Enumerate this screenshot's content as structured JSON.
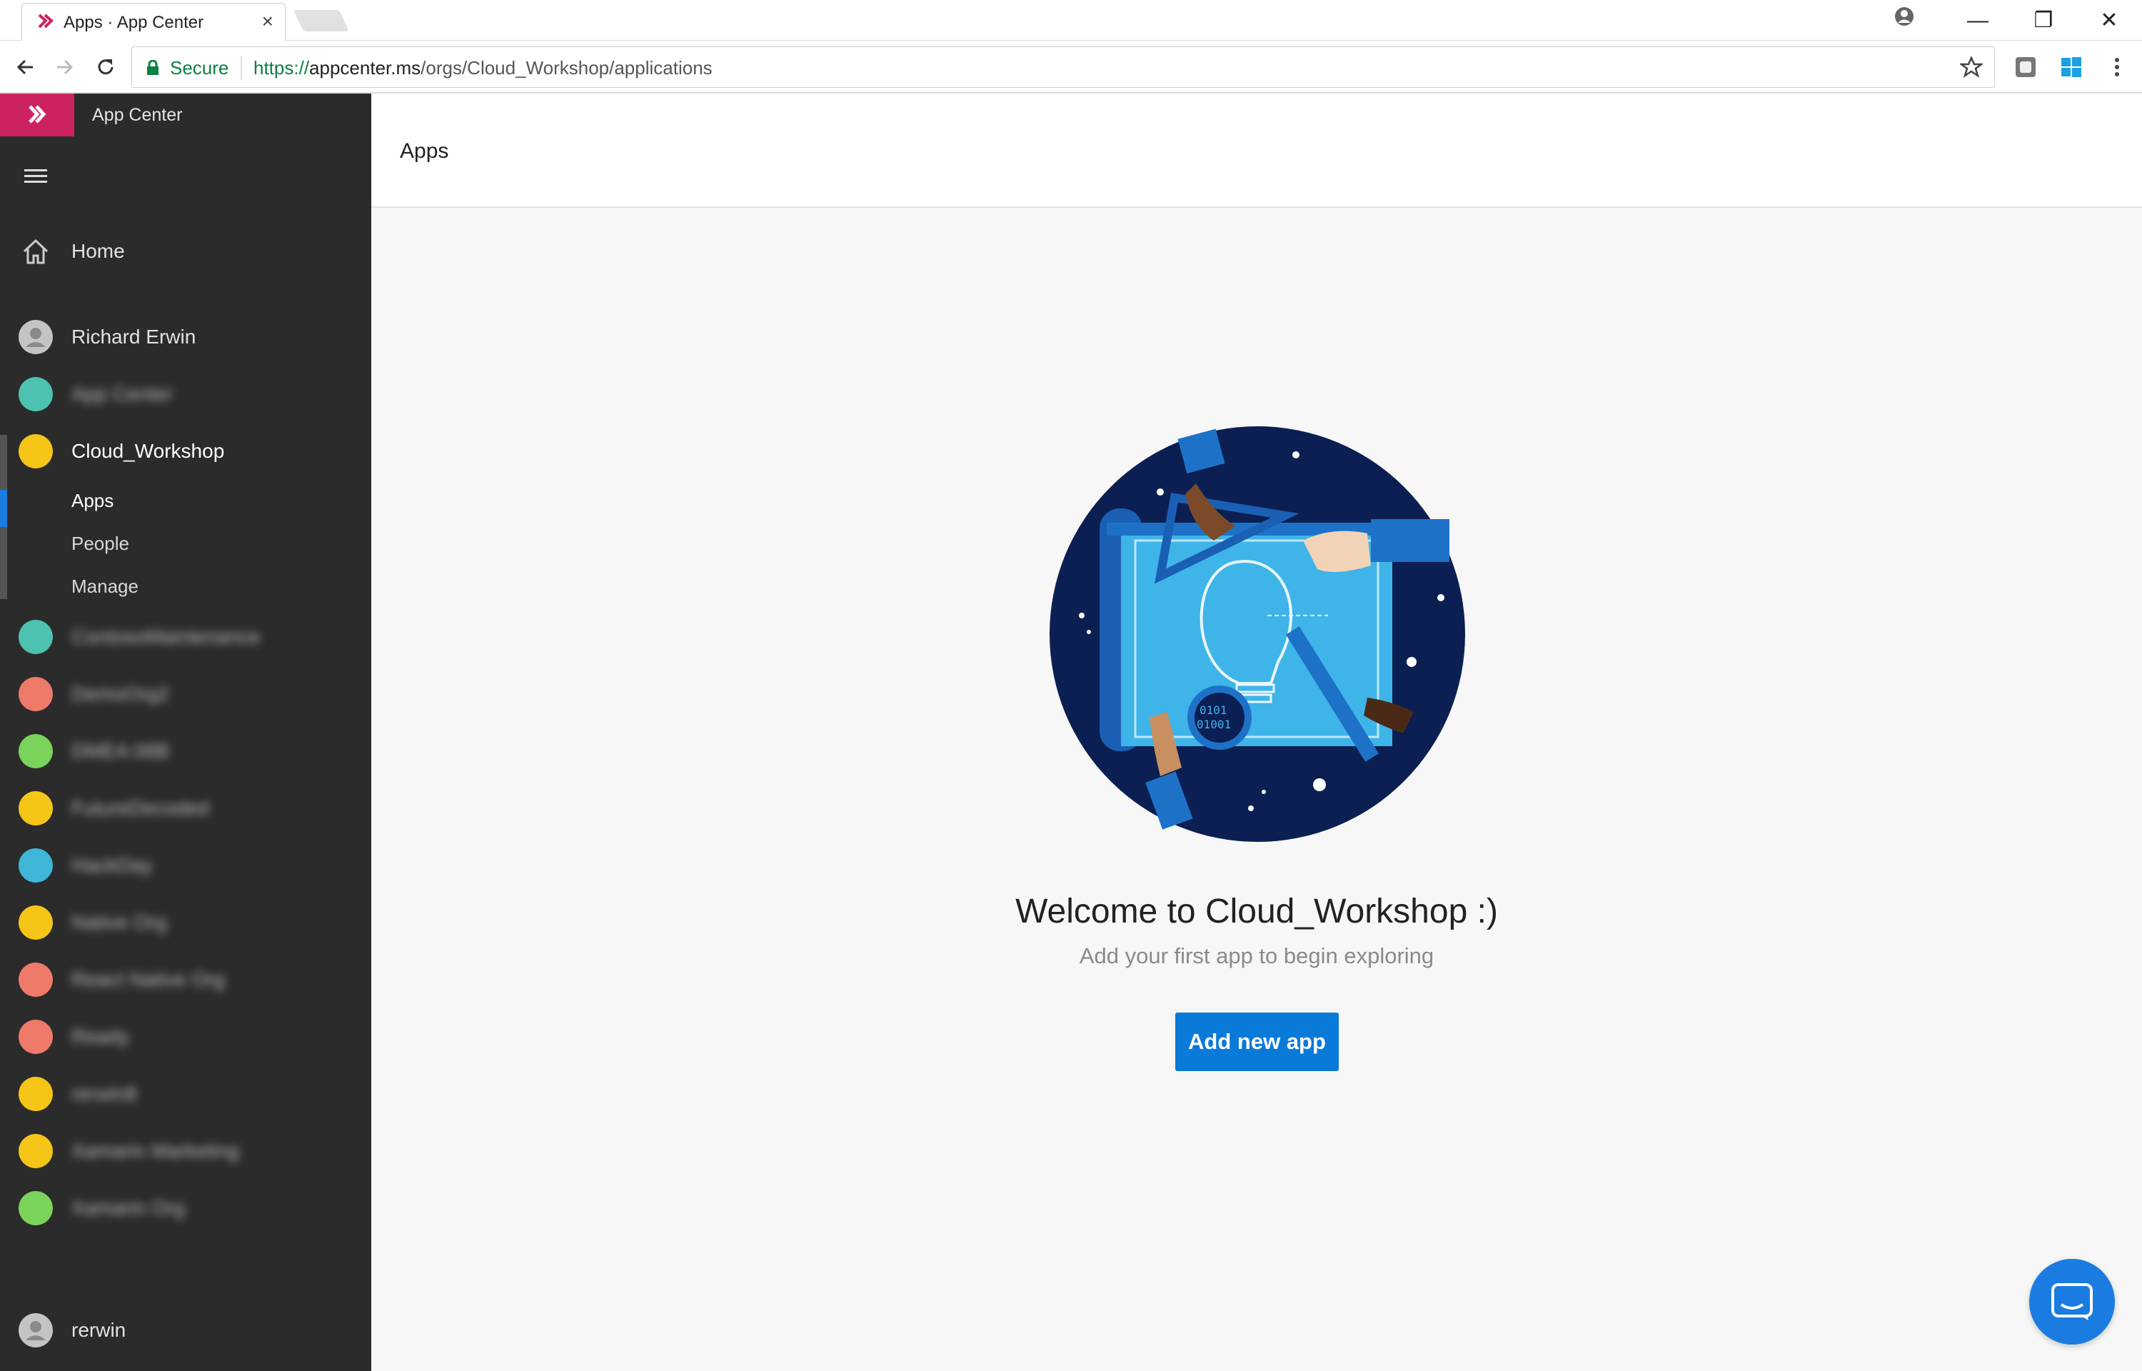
{
  "browser": {
    "tab_title": "Apps · App Center",
    "tab_close": "×",
    "secure_label": "Secure",
    "url_scheme": "https://",
    "url_host": "appcenter.ms",
    "url_path": "/orgs/Cloud_Workshop/applications",
    "window_minimize": "—",
    "window_restore": "❐",
    "window_close": "✕"
  },
  "sidebar": {
    "brand_name": "App Center",
    "home_label": "Home",
    "user_label": "Richard Erwin",
    "orgs_before": [
      {
        "label": "App Center",
        "color": "#4ec2b0"
      }
    ],
    "active_org": {
      "label": "Cloud_Workshop",
      "color": "#f5c518"
    },
    "active_org_sub": [
      "Apps",
      "People",
      "Manage"
    ],
    "orgs_after": [
      {
        "label": "ContosoMaintenance",
        "color": "#4ec2b0"
      },
      {
        "label": "DemoOrg2",
        "color": "#ef7a6a"
      },
      {
        "label": "DMEA 08B",
        "color": "#7ad35a"
      },
      {
        "label": "FutureDecoded",
        "color": "#f5c518"
      },
      {
        "label": "HackDay",
        "color": "#3fb6d8"
      },
      {
        "label": "Native Org",
        "color": "#f5c518"
      },
      {
        "label": "React Native Org",
        "color": "#ef7a6a"
      },
      {
        "label": "Ready",
        "color": "#ef7a6a"
      },
      {
        "label": "rerwin8",
        "color": "#f5c518"
      },
      {
        "label": "Xamarin Marketing",
        "color": "#f5c518"
      },
      {
        "label": "Xamarin Org",
        "color": "#7ad35a"
      }
    ],
    "bottom_user_label": "rerwin"
  },
  "main": {
    "header_title": "Apps",
    "welcome": "Welcome to Cloud_Workshop :)",
    "subtitle": "Add your first app to begin exploring",
    "add_button": "Add new app"
  },
  "colors": {
    "brand": "#cc2360",
    "accent": "#0a7ad9",
    "sidebar_bg": "#2b2b2b"
  }
}
